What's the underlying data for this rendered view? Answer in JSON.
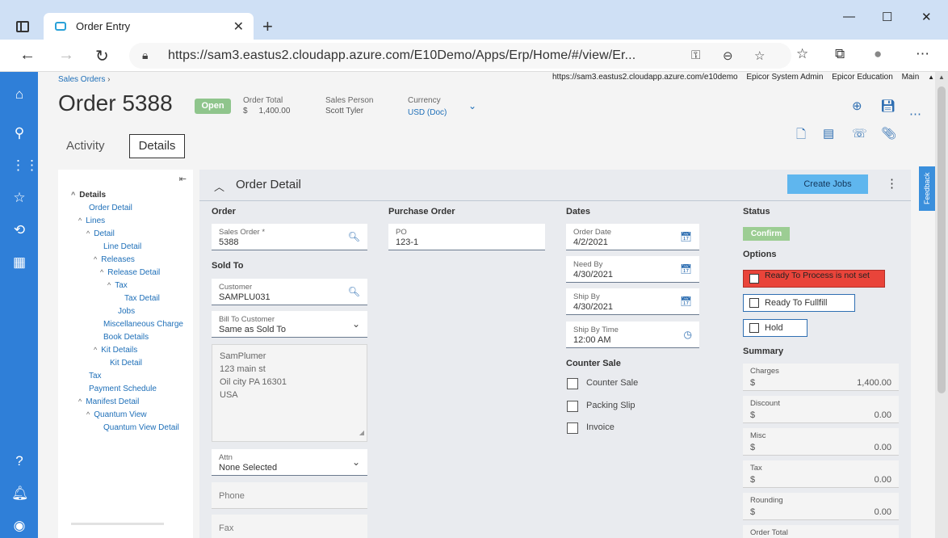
{
  "browser": {
    "tab_title": "Order Entry",
    "url": "https://sam3.eastus2.cloudapp.azure.com/E10Demo/Apps/Erp/Home/#/view/Er...",
    "icons": [
      "sidebar-toggle-icon",
      "new-tab-icon",
      "minimize-icon",
      "maximize-icon",
      "close-window-icon",
      "back-icon",
      "forward-icon",
      "refresh-icon",
      "lock-icon",
      "key-icon",
      "zoom-icon",
      "add-favorite-icon",
      "favorites-icon",
      "collections-icon",
      "profile-icon",
      "more-icon"
    ]
  },
  "header": {
    "breadcrumb": "Sales Orders",
    "breadcrumb_sep": "›",
    "right_links": [
      "https://sam3.eastus2.cloudapp.azure.com/e10demo",
      "Epicor System Admin",
      "Epicor Education",
      "Main"
    ],
    "title": "Order 5388",
    "status": "Open",
    "order_total_label": "Order Total",
    "order_total_currency": "$",
    "order_total_value": "1,400.00",
    "sales_person_label": "Sales Person",
    "sales_person_value": "Scott Tyler",
    "currency_label": "Currency",
    "currency_value": "USD (Doc)"
  },
  "tabs": {
    "activity": "Activity",
    "details": "Details"
  },
  "tree": {
    "items": [
      {
        "label": "Details",
        "toggle": "^"
      },
      {
        "label": "Order Detail",
        "toggle": ""
      },
      {
        "label": "Lines",
        "toggle": "^"
      },
      {
        "label": "Detail",
        "toggle": "^"
      },
      {
        "label": "Line Detail",
        "toggle": ""
      },
      {
        "label": "Releases",
        "toggle": "^"
      },
      {
        "label": "Release Detail",
        "toggle": "^"
      },
      {
        "label": "Tax",
        "toggle": "^"
      },
      {
        "label": "Tax Detail",
        "toggle": ""
      },
      {
        "label": "Jobs",
        "toggle": ""
      },
      {
        "label": "Miscellaneous Charge",
        "toggle": ""
      },
      {
        "label": "Book Details",
        "toggle": ""
      },
      {
        "label": "Kit Details",
        "toggle": "^"
      },
      {
        "label": "Kit Detail",
        "toggle": ""
      },
      {
        "label": "Tax",
        "toggle": ""
      },
      {
        "label": "Payment Schedule",
        "toggle": ""
      },
      {
        "label": "Manifest Detail",
        "toggle": "^"
      },
      {
        "label": "Quantum View",
        "toggle": "^"
      },
      {
        "label": "Quantum View Detail",
        "toggle": ""
      }
    ]
  },
  "detail": {
    "title": "Order Detail",
    "create_jobs": "Create Jobs",
    "order": {
      "section": "Order",
      "sales_order_label": "Sales Order *",
      "sales_order_value": "5388",
      "sold_to_section": "Sold To",
      "customer_label": "Customer",
      "customer_value": "SAMPLU031",
      "bill_to_label": "Bill To Customer",
      "bill_to_value": "Same as Sold To",
      "address_lines": [
        "SamPlumer",
        "123 main st",
        "Oil city PA 16301",
        "USA"
      ],
      "attn_label": "Attn",
      "attn_value": "None Selected",
      "phone_placeholder": "Phone",
      "fax_placeholder": "Fax"
    },
    "purchase_order": {
      "section": "Purchase Order",
      "po_label": "PO",
      "po_value": "123-1"
    },
    "dates": {
      "section": "Dates",
      "order_date_label": "Order Date",
      "order_date_value": "4/2/2021",
      "need_by_label": "Need By",
      "need_by_value": "4/30/2021",
      "ship_by_label": "Ship By",
      "ship_by_value": "4/30/2021",
      "ship_by_time_label": "Ship By Time",
      "ship_by_time_value": "12:00 AM",
      "counter_sale_section": "Counter Sale",
      "counter_sale": "Counter Sale",
      "packing_slip": "Packing Slip",
      "invoice": "Invoice"
    },
    "status": {
      "section": "Status",
      "confirm": "Confirm",
      "options_section": "Options",
      "ready_to_process": "Ready To Process is not set",
      "ready_to_fulfill": "Ready To Fullfill",
      "hold": "Hold",
      "summary_section": "Summary",
      "charges_label": "Charges",
      "charges_currency": "$",
      "charges_value": "1,400.00",
      "discount_label": "Discount",
      "discount_currency": "$",
      "discount_value": "0.00",
      "misc_label": "Misc",
      "misc_currency": "$",
      "misc_value": "0.00",
      "tax_label": "Tax",
      "tax_currency": "$",
      "tax_value": "0.00",
      "rounding_label": "Rounding",
      "rounding_currency": "$",
      "rounding_value": "0.00",
      "order_total_label": "Order Total"
    }
  },
  "feedback": "Feedback",
  "colors": {
    "rail": "#2f7fd8",
    "open_badge": "#8fc58c",
    "confirm_badge": "#9ccd93",
    "alert": "#e9443a",
    "create_jobs": "#5fb6ee"
  }
}
